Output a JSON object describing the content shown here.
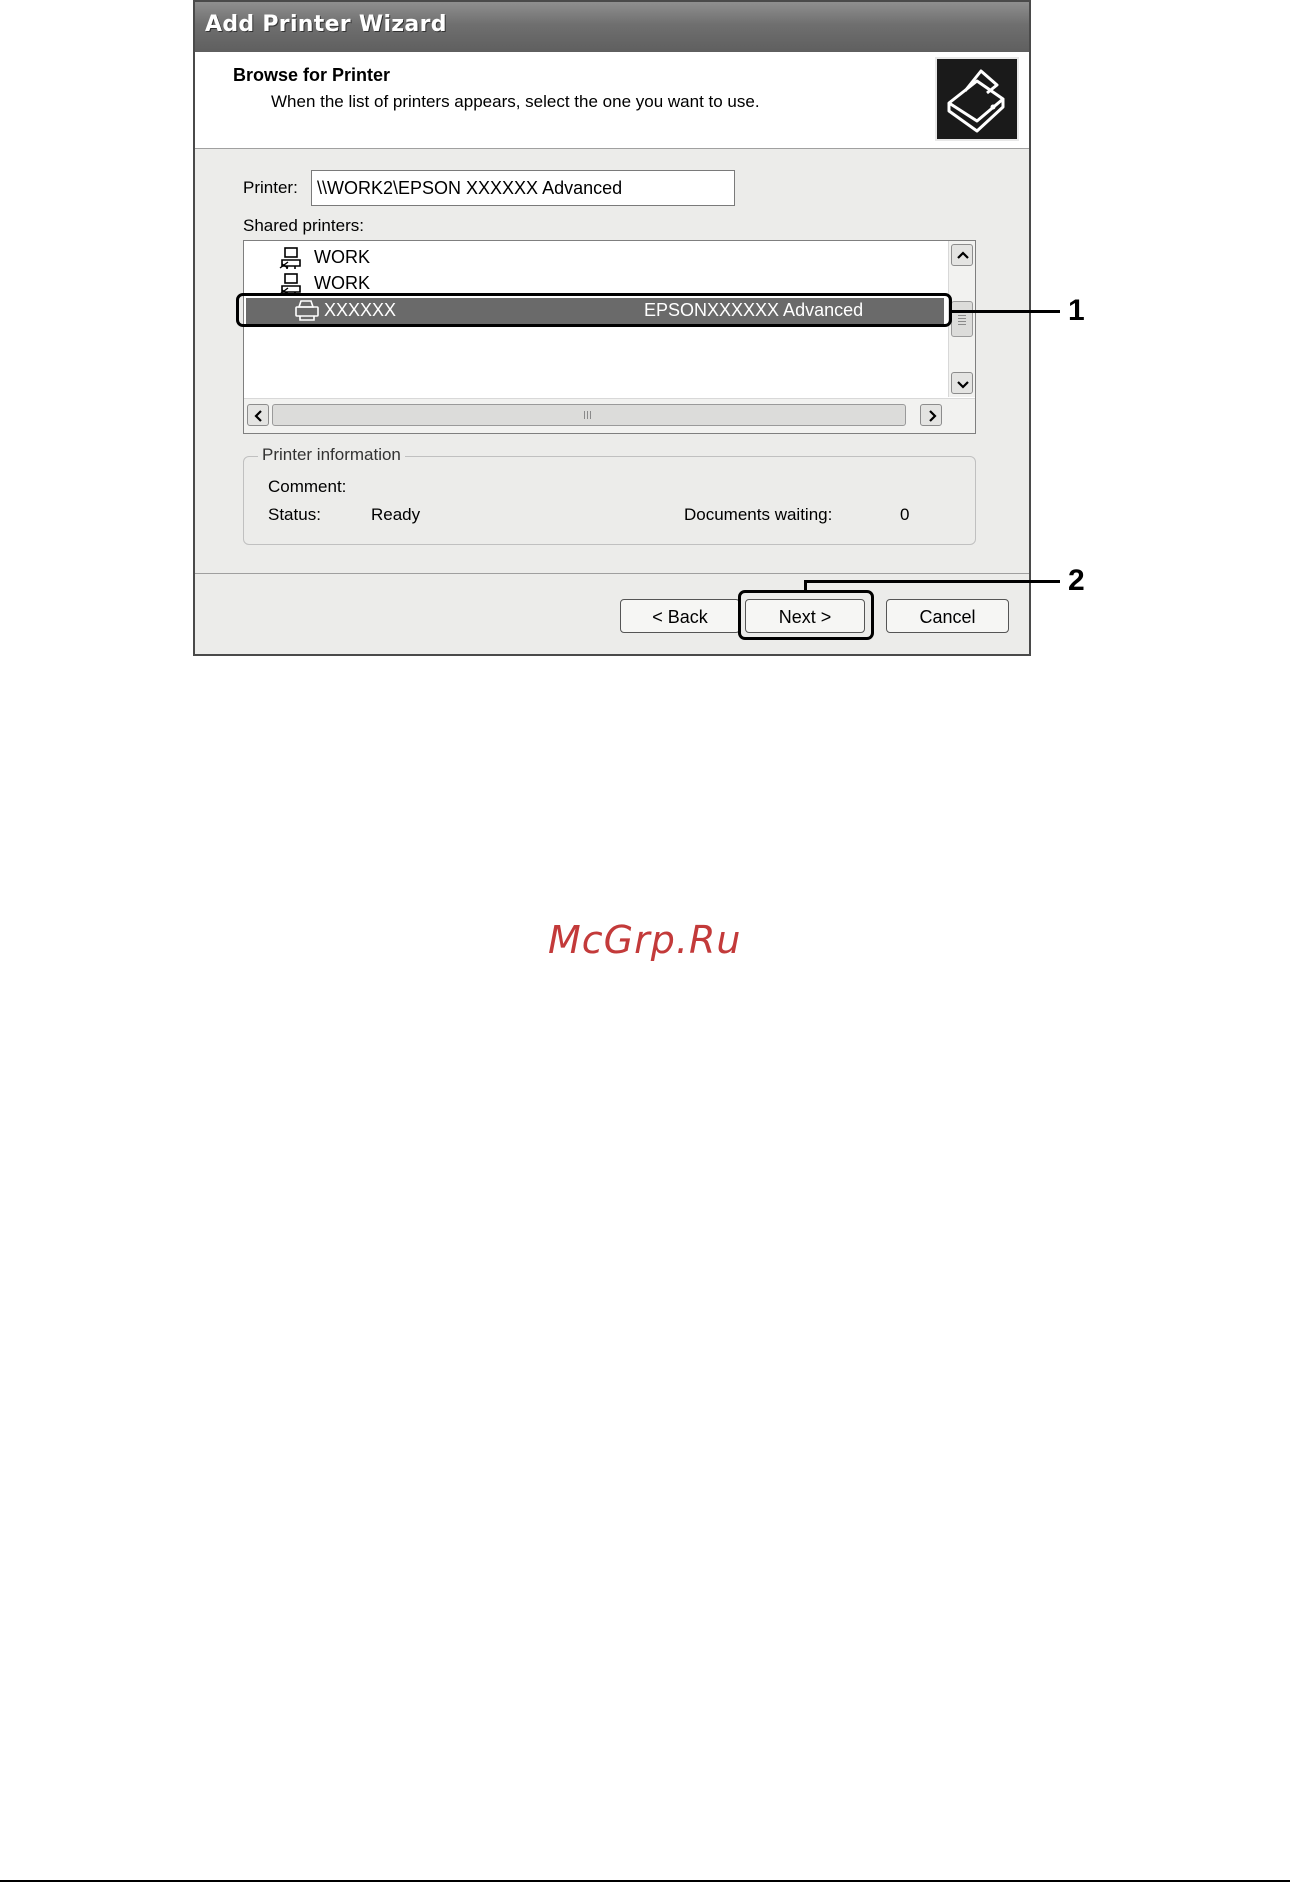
{
  "window": {
    "title": "Add Printer Wizard"
  },
  "header": {
    "title": "Browse for Printer",
    "subtitle": "When the list of printers appears, select the one you want to use.",
    "icon": "printer-wizard-icon"
  },
  "printer_field": {
    "label": "Printer:",
    "value": "\\\\WORK2\\EPSON XXXXXX Advanced"
  },
  "shared_printers": {
    "label": "Shared printers:",
    "items": [
      {
        "name": "WORK",
        "icon": "network-computer-icon"
      },
      {
        "name": "WORK",
        "icon": "network-computer-icon"
      },
      {
        "name": "XXXXXX",
        "description": "EPSONXXXXXX Advanced",
        "icon": "printer-icon",
        "selected": true
      }
    ]
  },
  "printer_information": {
    "title": "Printer information",
    "comment_label": "Comment:",
    "comment_value": "",
    "status_label": "Status:",
    "status_value": "Ready",
    "documents_label": "Documents waiting:",
    "documents_value": "0"
  },
  "buttons": {
    "back": "< Back",
    "next": "Next >",
    "cancel": "Cancel"
  },
  "callouts": {
    "one": "1",
    "two": "2"
  },
  "watermark": "McGrp.Ru"
}
